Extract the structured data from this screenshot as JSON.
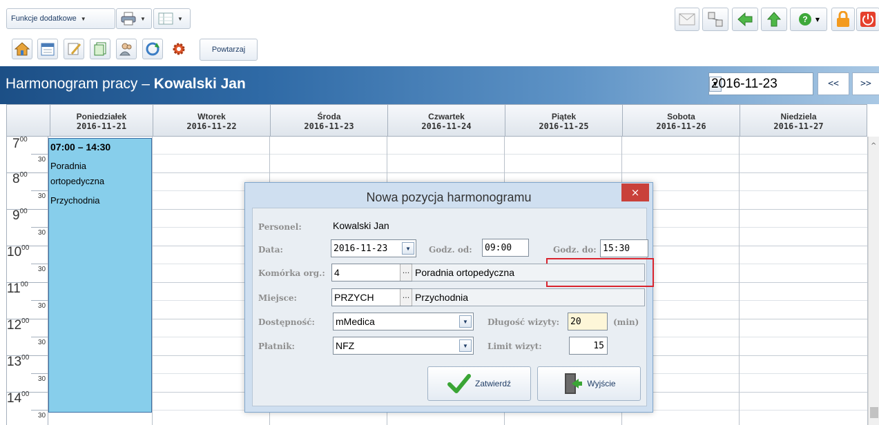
{
  "toolbar": {
    "dropdown_label": "Funkcje dodatkowe",
    "repeat_label": "Powtarzaj"
  },
  "header": {
    "title_prefix": "Harmonogram pracy – ",
    "title_person": "Kowalski Jan",
    "date": "2016-11-23",
    "prev_label": "<<",
    "next_label": ">>"
  },
  "schedule": {
    "days": [
      {
        "name": "Poniedziałek",
        "date": "2016-11-21"
      },
      {
        "name": "Wtorek",
        "date": "2016-11-22"
      },
      {
        "name": "Środa",
        "date": "2016-11-23"
      },
      {
        "name": "Czwartek",
        "date": "2016-11-24"
      },
      {
        "name": "Piątek",
        "date": "2016-11-25"
      },
      {
        "name": "Sobota",
        "date": "2016-11-26"
      },
      {
        "name": "Niedziela",
        "date": "2016-11-27"
      }
    ],
    "hours": [
      "7",
      "8",
      "9",
      "10",
      "11",
      "12",
      "13",
      "14"
    ],
    "hour_minutes": "00",
    "half_label": "30",
    "event": {
      "time": "07:00 – 14:30",
      "line1": "Poradnia",
      "line2": "ortopedyczna",
      "line3": "Przychodnia"
    }
  },
  "dialog": {
    "title": "Nowa pozycja harmonogramu",
    "close": "×",
    "personel_label": "Personel:",
    "personel_value": "Kowalski Jan",
    "data_label": "Data:",
    "data_value": "2016-11-23",
    "godz_od_label": "Godz. od:",
    "godz_od_value": "09:00",
    "godz_do_label": "Godz. do:",
    "godz_do_value": "15:30",
    "komorka_label": "Komórka org.:",
    "komorka_code": "4",
    "komorka_name": "Poradnia ortopedyczna",
    "miejsce_label": "Miejsce:",
    "miejsce_code": "PRZYCH",
    "miejsce_name": "Przychodnia",
    "dostepnosc_label": "Dostępność:",
    "dostepnosc_value": "mMedica",
    "dlugosc_label": "Długość wizyty:",
    "dlugosc_value": "20",
    "dlugosc_unit": "(min)",
    "platnik_label": "Płatnik:",
    "platnik_value": "NFZ",
    "limit_label": "Limit wizyt:",
    "limit_value": "15",
    "ellipsis": "...",
    "confirm_label": "Zatwierdź",
    "exit_label": "Wyjście"
  },
  "colors": {
    "event_fill": "#87ceeb",
    "title_gradient_start": "#1c4f86",
    "highlight": "#d9232d",
    "close_button": "#c9413a"
  }
}
